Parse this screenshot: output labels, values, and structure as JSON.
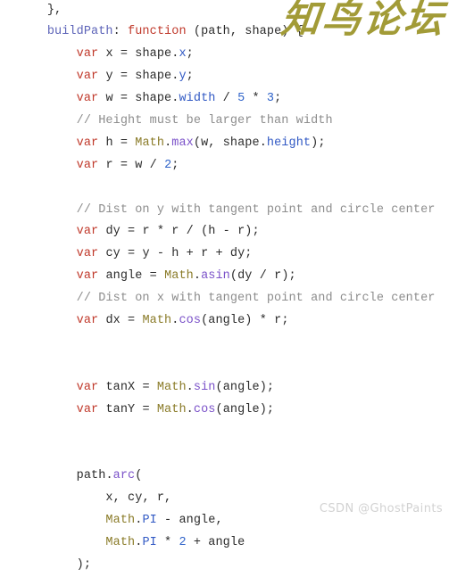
{
  "page": {
    "kind": "code-snippet-screenshot",
    "background_color": "#ffffff",
    "language": "javascript"
  },
  "theme": {
    "text_color": "#2b2b2b",
    "keyword_color": "#c0392b",
    "property_key_color": "#5c63b8",
    "comment_color": "#8d8d8d",
    "object_color": "#8a7b28",
    "method_color": "#7b52c9",
    "member_color": "#3159c4",
    "number_color": "#2f63c9"
  },
  "watermarks": {
    "forum": {
      "text": "知鸟论坛",
      "color": "#a29b37"
    },
    "csdn": {
      "text": "CSDN @GhostPaints",
      "color": "#d2d2d2"
    }
  },
  "code": {
    "lines": [
      {
        "id": "line-0",
        "text": "    },"
      },
      {
        "id": "line-1",
        "text": "    buildPath: function (path, shape) {"
      },
      {
        "id": "line-2",
        "text": "        var x = shape.x;"
      },
      {
        "id": "line-3",
        "text": "        var y = shape.y;"
      },
      {
        "id": "line-4",
        "text": "        var w = shape.width / 5 * 3;"
      },
      {
        "id": "line-5",
        "text": "        // Height must be larger than width"
      },
      {
        "id": "line-6",
        "text": "        var h = Math.max(w, shape.height);"
      },
      {
        "id": "line-7",
        "text": "        var r = w / 2;"
      },
      {
        "id": "line-8",
        "text": ""
      },
      {
        "id": "line-9",
        "text": "        // Dist on y with tangent point and circle center"
      },
      {
        "id": "line-10",
        "text": "        var dy = r * r / (h - r);"
      },
      {
        "id": "line-11",
        "text": "        var cy = y - h + r + dy;"
      },
      {
        "id": "line-12",
        "text": "        var angle = Math.asin(dy / r);"
      },
      {
        "id": "line-13",
        "text": "        // Dist on x with tangent point and circle center"
      },
      {
        "id": "line-14",
        "text": "        var dx = Math.cos(angle) * r;"
      },
      {
        "id": "line-15",
        "text": ""
      },
      {
        "id": "line-16",
        "text": ""
      },
      {
        "id": "line-17",
        "text": "        var tanX = Math.sin(angle);"
      },
      {
        "id": "line-18",
        "text": "        var tanY = Math.cos(angle);"
      },
      {
        "id": "line-19",
        "text": ""
      },
      {
        "id": "line-20",
        "text": ""
      },
      {
        "id": "line-21",
        "text": "        path.arc("
      },
      {
        "id": "line-22",
        "text": "            x, cy, r,"
      },
      {
        "id": "line-23",
        "text": "            Math.PI - angle,"
      },
      {
        "id": "line-24",
        "text": "            Math.PI * 2 + angle"
      },
      {
        "id": "line-25",
        "text": "        );"
      }
    ]
  }
}
